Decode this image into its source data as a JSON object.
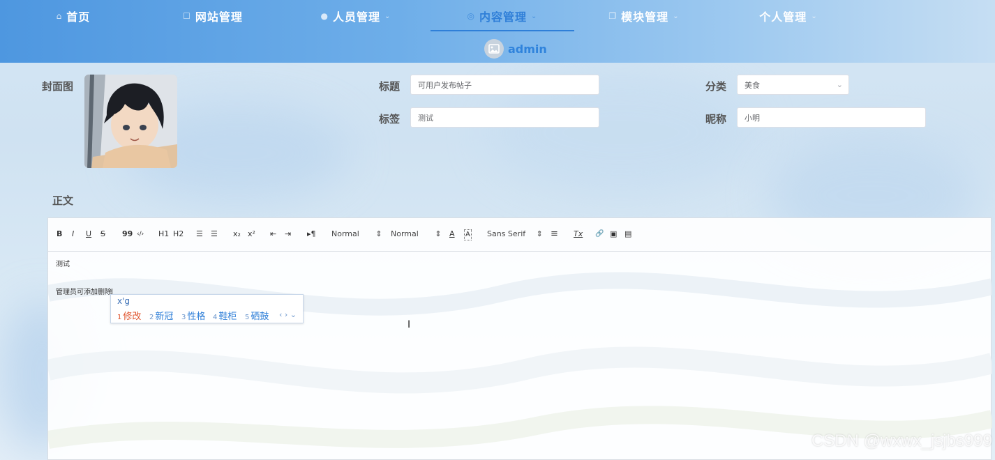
{
  "nav": {
    "items": [
      {
        "label": "首页",
        "icon": "home-icon",
        "has_menu": false
      },
      {
        "label": "网站管理",
        "icon": "square-icon",
        "has_menu": true
      },
      {
        "label": "人员管理",
        "icon": "user-icon",
        "has_menu": true
      },
      {
        "label": "内容管理",
        "icon": "message-icon",
        "has_menu": true,
        "active": true
      },
      {
        "label": "模块管理",
        "icon": "copy-icon",
        "has_menu": true
      },
      {
        "label": "个人管理",
        "icon": "",
        "has_menu": true
      }
    ],
    "user": {
      "name": "admin",
      "avatar_icon": "image-icon"
    },
    "accent_color": "#2f7fd8"
  },
  "form": {
    "cover_label": "封面图",
    "title_label": "标题",
    "title_value": "可用户发布帖子",
    "category_label": "分类",
    "category_value": "美食",
    "tag_label": "标签",
    "tag_value": "测试",
    "nickname_label": "昵称",
    "nickname_value": "小明",
    "body_label": "正文"
  },
  "editor": {
    "toolbar": {
      "bold": "B",
      "italic": "I",
      "underline": "U",
      "strike": "S",
      "blockquote": "99",
      "code": "‹/›",
      "h1": "H1",
      "h2": "H2",
      "ordered_list": "☰",
      "bullet_list": "☰",
      "subscript": "x₂",
      "superscript": "x²",
      "outdent": "⇤",
      "indent": "⇥",
      "direction": "▸¶",
      "size_select": "Normal",
      "header_select": "Normal",
      "font_color": "A",
      "background_color": "A",
      "font_select": "Sans Serif",
      "align": "≡",
      "clean": "Tx",
      "link": "🔗",
      "image": "▣",
      "video": "▤"
    },
    "content_lines": [
      "测试",
      "管理员可添加删除"
    ]
  },
  "ime": {
    "pinyin": "x'g",
    "candidates": [
      {
        "n": "1",
        "text": "修改"
      },
      {
        "n": "2",
        "text": "新冠"
      },
      {
        "n": "3",
        "text": "性格"
      },
      {
        "n": "4",
        "text": "鞋柜"
      },
      {
        "n": "5",
        "text": "硒鼓"
      }
    ],
    "nav_glyphs": "‹ › ⌄"
  },
  "watermark": "CSDN @wxwx_jsjbs999"
}
